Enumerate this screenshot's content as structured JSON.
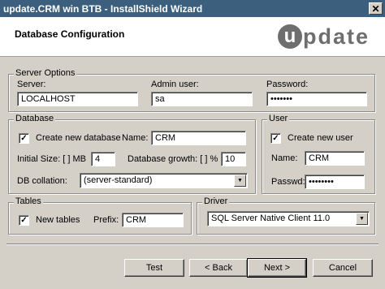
{
  "window": {
    "title": "update.CRM win BTB - InstallShield Wizard"
  },
  "header": {
    "page_title": "Database Configuration",
    "logo_letter": "u",
    "logo_text": "pdate"
  },
  "server_options": {
    "legend": "Server Options",
    "server_label": "Server:",
    "server_value": "LOCALHOST",
    "admin_label": "Admin user:",
    "admin_value": "sa",
    "password_label": "Password:",
    "password_value": "•••••••"
  },
  "database": {
    "legend": "Database",
    "create_new_label": "Create new database",
    "create_new_checked": "✓",
    "name_label": "Name:",
    "name_value": "CRM",
    "initial_size_label": "Initial Size: [ ] MB",
    "initial_size_value": "4",
    "growth_label": "Database growth: [ ] %",
    "growth_value": "10",
    "collation_label": "DB collation:",
    "collation_value": "(server-standard)"
  },
  "user": {
    "legend": "User",
    "create_new_label": "Create new user",
    "create_new_checked": "✓",
    "name_label": "Name:",
    "name_value": "CRM",
    "passwd_label": "Passwd:",
    "passwd_value": "••••••••"
  },
  "tables": {
    "legend": "Tables",
    "new_tables_label": "New tables",
    "new_tables_checked": "✓",
    "prefix_label": "Prefix:",
    "prefix_value": "CRM"
  },
  "driver": {
    "legend": "Driver",
    "value": "SQL Server Native Client 11.0"
  },
  "buttons": {
    "test": "Test",
    "back": "< Back",
    "next": "Next >",
    "cancel": "Cancel"
  }
}
